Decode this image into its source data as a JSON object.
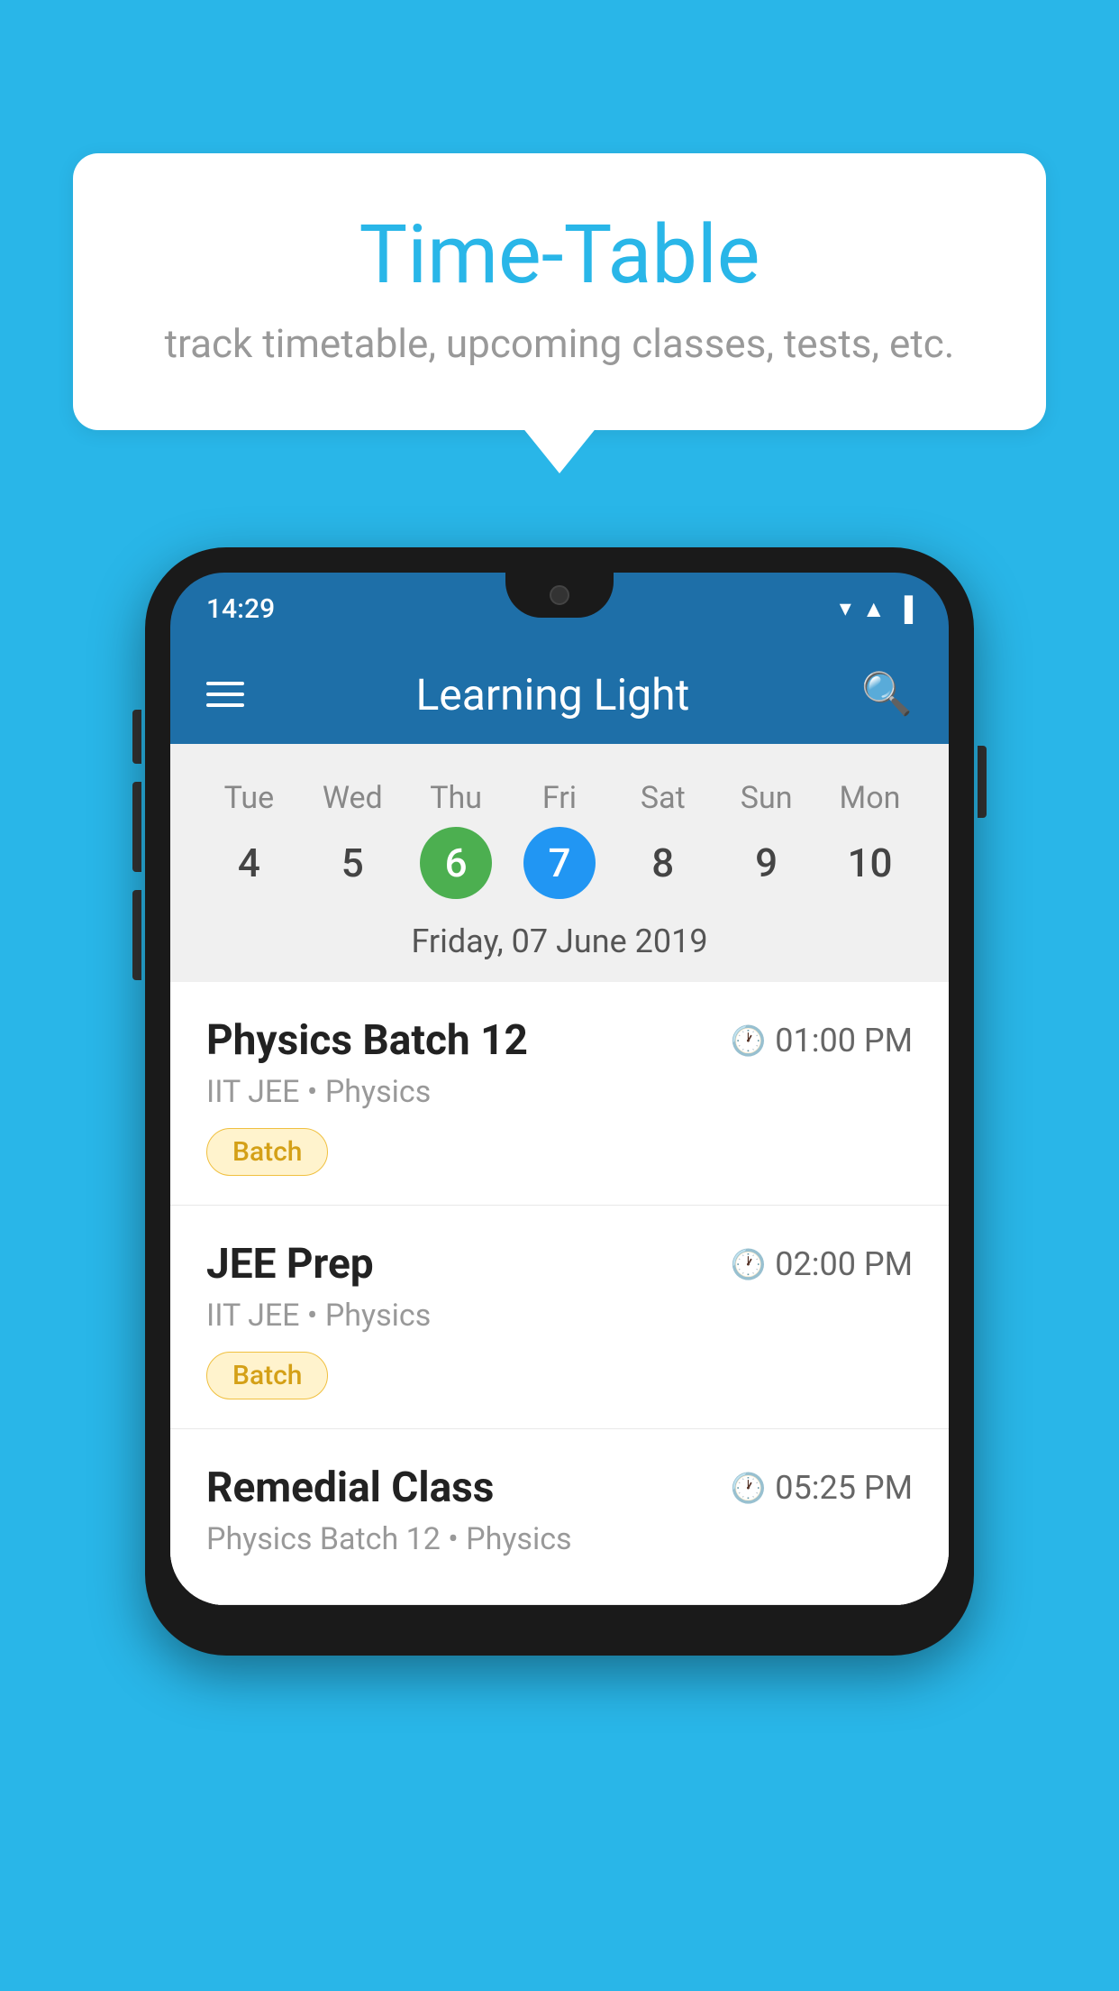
{
  "background": {
    "color": "#29B6E8"
  },
  "speech_bubble": {
    "title": "Time-Table",
    "subtitle": "track timetable, upcoming classes, tests, etc."
  },
  "phone": {
    "status_bar": {
      "time": "14:29"
    },
    "app_bar": {
      "title": "Learning Light"
    },
    "calendar": {
      "days": [
        {
          "name": "Tue",
          "num": "4",
          "state": "normal"
        },
        {
          "name": "Wed",
          "num": "5",
          "state": "normal"
        },
        {
          "name": "Thu",
          "num": "6",
          "state": "today"
        },
        {
          "name": "Fri",
          "num": "7",
          "state": "selected"
        },
        {
          "name": "Sat",
          "num": "8",
          "state": "normal"
        },
        {
          "name": "Sun",
          "num": "9",
          "state": "normal"
        },
        {
          "name": "Mon",
          "num": "10",
          "state": "normal"
        }
      ],
      "selected_date_label": "Friday, 07 June 2019"
    },
    "schedule": [
      {
        "title": "Physics Batch 12",
        "time": "01:00 PM",
        "detail": "IIT JEE • Physics",
        "tag": "Batch"
      },
      {
        "title": "JEE Prep",
        "time": "02:00 PM",
        "detail": "IIT JEE • Physics",
        "tag": "Batch"
      },
      {
        "title": "Remedial Class",
        "time": "05:25 PM",
        "detail": "Physics Batch 12 • Physics",
        "tag": null
      }
    ]
  }
}
